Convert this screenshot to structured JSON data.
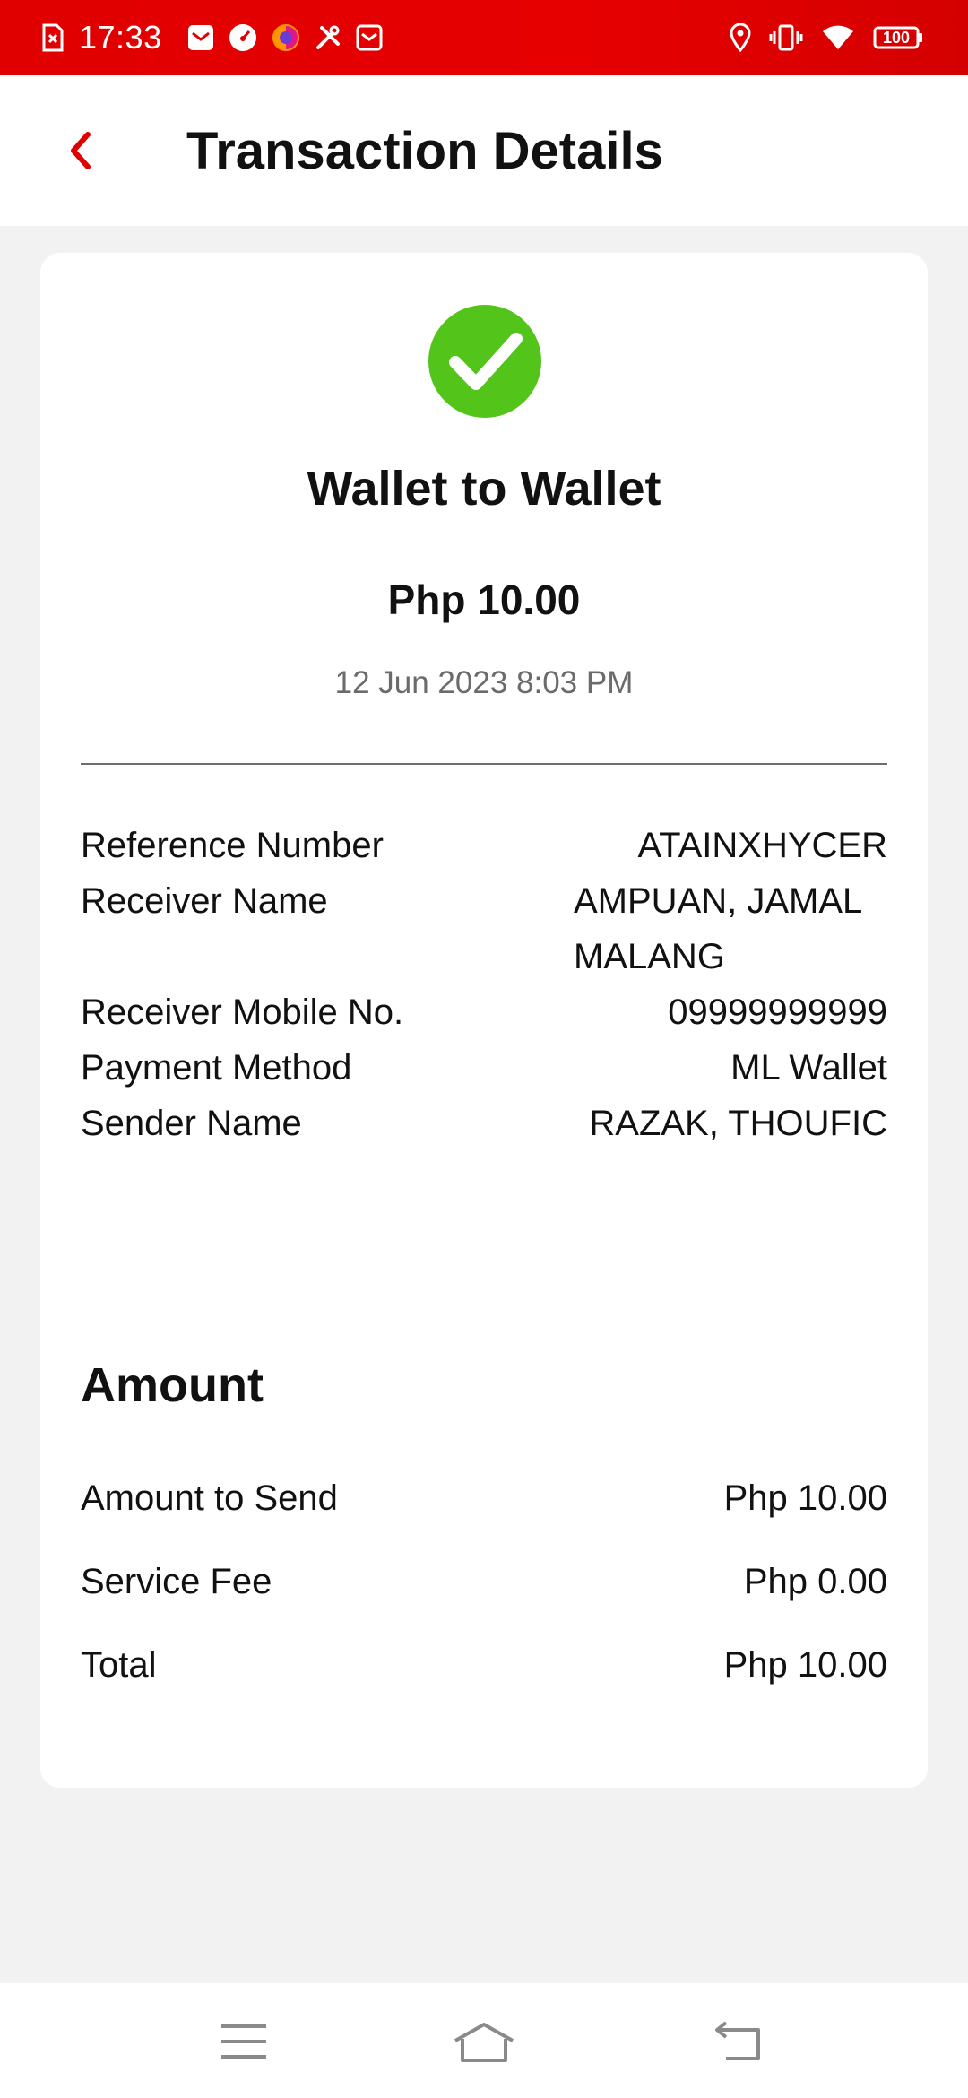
{
  "status_bar": {
    "time": "17:33",
    "battery": "100",
    "left_icons": [
      "sim-alert-icon",
      "mail-icon",
      "speedometer-icon",
      "firefox-icon",
      "tools-icon",
      "inbox-icon"
    ],
    "right_icons": [
      "location-icon",
      "vibrate-icon",
      "wifi-icon",
      "battery-icon"
    ]
  },
  "app_bar": {
    "title": "Transaction Details",
    "back_icon": "chevron-left-icon"
  },
  "transaction": {
    "type": "Wallet to Wallet",
    "amount": "Php 10.00",
    "date": "12 Jun 2023 8:03 PM",
    "details": [
      {
        "label": "Reference Number",
        "value": "ATAINXHYCER"
      },
      {
        "label": "Receiver Name",
        "value_line1": "AMPUAN, JAMAL",
        "value_line2": "MALANG"
      },
      {
        "label": "Receiver Mobile No.",
        "value": "09999999999"
      },
      {
        "label": "Payment Method",
        "value": "ML Wallet"
      },
      {
        "label": "Sender Name",
        "value": "RAZAK, THOUFIC"
      }
    ]
  },
  "amount_section": {
    "heading": "Amount",
    "rows": [
      {
        "label": "Amount to Send",
        "value": "Php 10.00"
      },
      {
        "label": "Service Fee",
        "value": "Php 0.00"
      },
      {
        "label": "Total",
        "value": "Php 10.00"
      }
    ]
  },
  "nav": {
    "icons": [
      "menu-icon",
      "home-icon",
      "back-icon"
    ]
  },
  "colors": {
    "brand_red": "#e00000",
    "success_green": "#52c41a",
    "background": "#f2f2f2"
  }
}
